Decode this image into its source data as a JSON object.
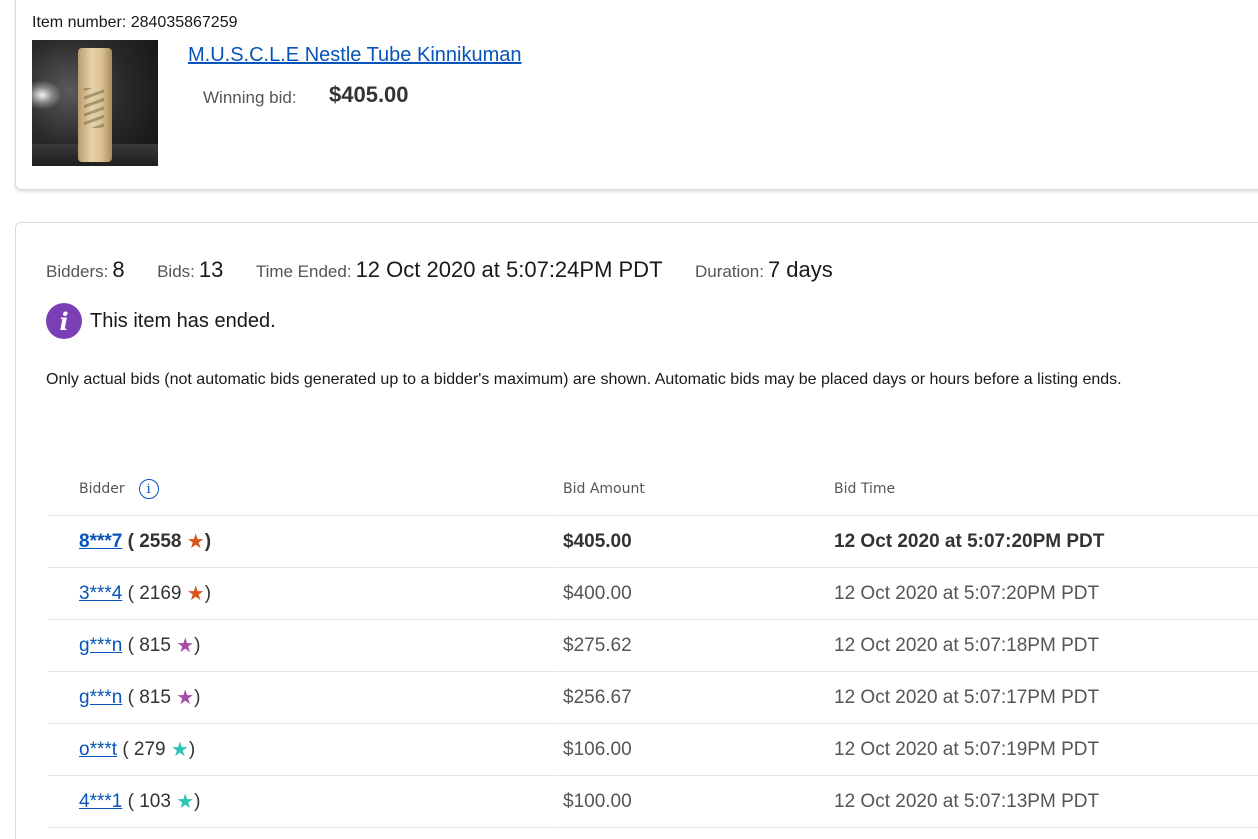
{
  "item": {
    "number_label": "Item number:",
    "number": "284035867259",
    "title": "M.U.S.C.L.E Nestle Tube Kinnikuman",
    "winning_bid_label": "Winning bid:",
    "winning_bid": "$405.00"
  },
  "summary": {
    "bidders_label": "Bidders:",
    "bidders": "8",
    "bids_label": "Bids:",
    "bids": "13",
    "time_ended_label": "Time Ended:",
    "time_ended": "12 Oct 2020 at 5:07:24PM PDT",
    "duration_label": "Duration:",
    "duration": "7 days"
  },
  "status": {
    "icon": "info-icon",
    "icon_glyph": "i",
    "message": "This item has ended."
  },
  "note": "Only actual bids (not automatic bids generated up to a bidder's maximum) are shown. Automatic bids may be placed days or hours before a listing ends.",
  "table": {
    "headers": {
      "bidder": "Bidder",
      "bidder_info_glyph": "i",
      "amount": "Bid Amount",
      "time": "Bid Time"
    },
    "rows": [
      {
        "bidder": "8***7",
        "score_open": "( ",
        "score": "2558",
        "star_color": "#d9541e",
        "score_close": ")",
        "amount": "$405.00",
        "time": "12 Oct 2020 at 5:07:20PM PDT",
        "star": "★"
      },
      {
        "bidder": "3***4",
        "score_open": "( ",
        "score": "2169",
        "star_color": "#d9541e",
        "score_close": ")",
        "amount": "$400.00",
        "time": "12 Oct 2020 at 5:07:20PM PDT",
        "star": "★"
      },
      {
        "bidder": "g***n",
        "score_open": "( ",
        "score": "815",
        "star_color": "#a54ea8",
        "score_close": ")",
        "amount": "$275.62",
        "time": "12 Oct 2020 at 5:07:18PM PDT",
        "star": "★"
      },
      {
        "bidder": "g***n",
        "score_open": "( ",
        "score": "815",
        "star_color": "#a54ea8",
        "score_close": ")",
        "amount": "$256.67",
        "time": "12 Oct 2020 at 5:07:17PM PDT",
        "star": "★"
      },
      {
        "bidder": "o***t",
        "score_open": "( ",
        "score": "279",
        "star_color": "#2fc3b6",
        "score_close": ")",
        "amount": "$106.00",
        "time": "12 Oct 2020 at 5:07:19PM PDT",
        "star": "★"
      },
      {
        "bidder": "4***1",
        "score_open": "( ",
        "score": "103",
        "star_color": "#2fc3b6",
        "score_close": ")",
        "amount": "$100.00",
        "time": "12 Oct 2020 at 5:07:13PM PDT",
        "star": "★"
      }
    ]
  },
  "colors": {
    "link": "#0654ba",
    "info_icon": "#7b3fb5"
  }
}
